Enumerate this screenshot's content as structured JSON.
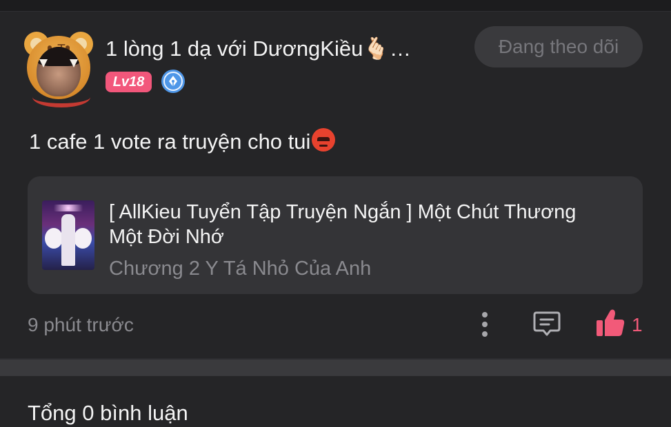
{
  "post": {
    "author": {
      "name": "1 lòng 1 dạ với DươngKiều🫰🏻…",
      "level": "Lv18",
      "avatar_icon": "tiger-hood-avatar",
      "badge_icon": "pen-nib-badge-icon"
    },
    "follow_label": "Đang theo dõi",
    "text": "1 cafe 1 vote ra truyện cho tui",
    "text_emoji": "angry-face-emoji",
    "story": {
      "title": "[ AllKieu Tuyển Tập Truyện Ngắn ] Một Chút Thương Một Đời Nhớ",
      "chapter": "Chương 2 Y Tá Nhỏ Của Anh"
    },
    "time": "9 phút trước",
    "like_count": "1",
    "icons": {
      "more": "more-vertical-icon",
      "comment": "comment-icon",
      "like": "thumbs-up-icon"
    }
  },
  "comments": {
    "total_label": "Tổng 0 bình luận"
  },
  "colors": {
    "background": "#252527",
    "card": "#343437",
    "accent_pink": "#f25a79",
    "level_badge": "#f2577b",
    "follow_button": "#3a3a3d",
    "muted_text": "#8a8a8f",
    "badge_blue": "#4f97e8"
  }
}
